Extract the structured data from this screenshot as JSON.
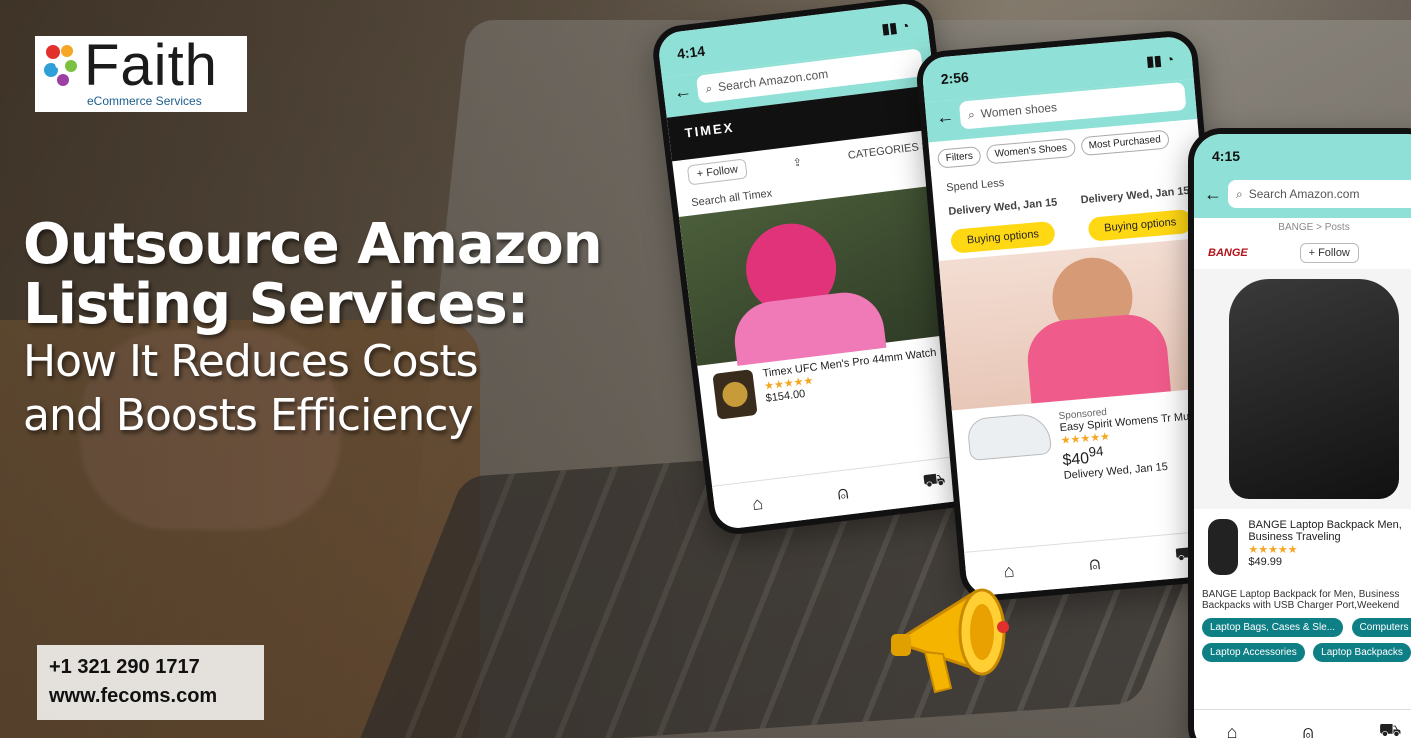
{
  "brand": {
    "name": "Faith",
    "tagline": "eCommerce Services",
    "logo_colors": [
      "#e2312d",
      "#f5a623",
      "#2e9fd9",
      "#7cc242",
      "#9b3fa2"
    ]
  },
  "headline": {
    "line1": "Outsource Amazon",
    "line2": "Listing Services:",
    "line3": "How It Reduces Costs",
    "line4": "and Boosts Efficiency"
  },
  "contact": {
    "phone": "+1 321 290 1717",
    "website": "www.fecoms.com"
  },
  "phone1": {
    "time": "4:14",
    "search_placeholder": "Search Amazon.com",
    "store_brand": "TIMEX",
    "follow_label": "+ Follow",
    "categories_label": "CATEGORIES >",
    "search_store_placeholder": "Search all Timex",
    "product_title": "Timex UFC Men's Pro 44mm Watch",
    "product_rating": "★★★★★",
    "product_price": "$154.00"
  },
  "phone2": {
    "time": "2:56",
    "search_value": "Women shoes",
    "filters_label": "Filters",
    "chip_active": "Women's Shoes",
    "chip_other": "Most Purchased",
    "spend_label": "Spend Less",
    "delivery_1": "Delivery Wed, Jan 15",
    "delivery_2": "Delivery Wed, Jan 15",
    "buying_options": "Buying options",
    "sponsored": "Sponsored",
    "product_title": "Easy Spirit Womens Tr Mule",
    "product_rating": "★★★★★",
    "product_price": "$40",
    "product_price_cents": "94",
    "delivery_3": "Delivery Wed, Jan 15"
  },
  "phone3": {
    "time": "4:15",
    "search_placeholder": "Search Amazon.com",
    "breadcrumb": "BANGE > Posts",
    "store_brand": "BANGE",
    "follow_label": "+ Follow",
    "product_title": "BANGE Laptop Backpack Men, Business Traveling",
    "product_rating": "★★★★★",
    "product_price": "$49.99",
    "description": "BANGE Laptop Backpack for Men, Business Backpacks with USB Charger Port,Weekend",
    "tags": [
      "Laptop Bags, Cases & Sle...",
      "Computers &",
      "Laptop Accessories",
      "Laptop Backpacks"
    ]
  },
  "icons": {
    "home": "⌂",
    "account": "👤",
    "cart": "🛒",
    "search": "🔍",
    "share": "⇪",
    "back": "←"
  }
}
